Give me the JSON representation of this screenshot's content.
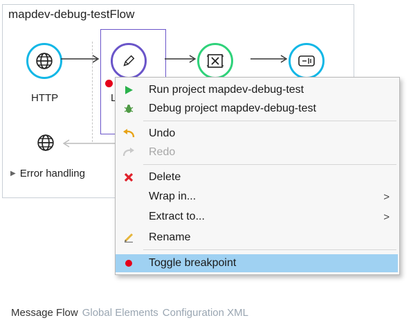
{
  "flow": {
    "title": "mapdev-debug-testFlow",
    "nodes": {
      "http_label": "HTTP",
      "logger_label": "L"
    },
    "error_handling_label": "Error handling"
  },
  "context_menu": {
    "items": [
      {
        "label": "Run project mapdev-debug-test",
        "icon": "run-icon"
      },
      {
        "label": "Debug project mapdev-debug-test",
        "icon": "debug-bug-icon"
      },
      {
        "label": "Undo",
        "icon": "undo-icon"
      },
      {
        "label": "Redo",
        "icon": "redo-icon",
        "disabled": true
      },
      {
        "label": "Delete",
        "icon": "delete-x-icon"
      },
      {
        "label": "Wrap in...",
        "submenu": ">"
      },
      {
        "label": "Extract to...",
        "submenu": ">"
      },
      {
        "label": "Rename",
        "icon": "rename-pencil-icon"
      },
      {
        "label": "Toggle breakpoint",
        "icon": "breakpoint-dot-icon",
        "highlighted": true
      }
    ]
  },
  "tabs": [
    {
      "label": "Message Flow",
      "active": true
    },
    {
      "label": "Global Elements",
      "active": false
    },
    {
      "label": "Configuration XML",
      "active": false
    }
  ],
  "colors": {
    "accent_blue": "#12b7e6",
    "accent_green": "#2fd27a",
    "selection_purple": "#6a55c9",
    "menu_highlight": "#9fd1f2",
    "breakpoint_red": "#e5001a"
  }
}
